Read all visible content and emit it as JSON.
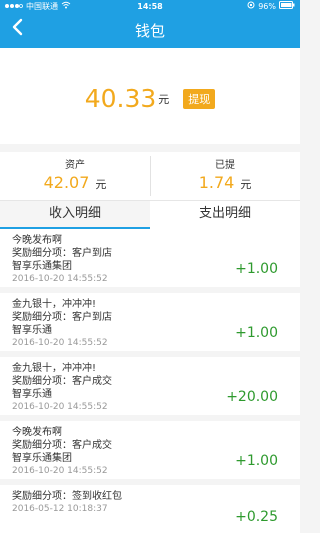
{
  "status_bar": {
    "carrier": "中国联通",
    "time": "14:58",
    "battery": "96%"
  },
  "nav": {
    "back_icon": "chevron-left-icon",
    "title": "钱包"
  },
  "balance": {
    "amount": "40.33",
    "unit": "元",
    "withdraw_label": "提现"
  },
  "stats": [
    {
      "label": "资产",
      "value": "42.07",
      "unit": "元"
    },
    {
      "label": "已提",
      "value": "1.74",
      "unit": "元"
    }
  ],
  "tabs": [
    {
      "label": "收入明细",
      "active": true
    },
    {
      "label": "支出明细",
      "active": false
    }
  ],
  "records": [
    {
      "title": "今晚发布啊",
      "detail": "奖励细分项：客户到店",
      "company": "智享乐通集团",
      "date": "2016-10-20 14:55:52",
      "amount": "+1.00"
    },
    {
      "title": "金九银十，冲冲冲!",
      "detail": "奖励细分项：客户到店",
      "company": "智享乐通",
      "date": "2016-10-20 14:55:52",
      "amount": "+1.00"
    },
    {
      "title": "金九银十，冲冲冲!",
      "detail": "奖励细分项：客户成交",
      "company": "智享乐通",
      "date": "2016-10-20 14:55:52",
      "amount": "+20.00"
    },
    {
      "title": "今晚发布啊",
      "detail": "奖励细分项：客户成交",
      "company": "智享乐通集团",
      "date": "2016-10-20 14:55:52",
      "amount": "+1.00"
    },
    {
      "title": "",
      "detail": "奖励细分项：签到收红包",
      "company": "",
      "date": "2016-05-12 10:18:37",
      "amount": "+0.25"
    }
  ],
  "colors": {
    "primary": "#1fa0e3",
    "accent": "#f2a91d",
    "income": "#2e9a2e"
  }
}
